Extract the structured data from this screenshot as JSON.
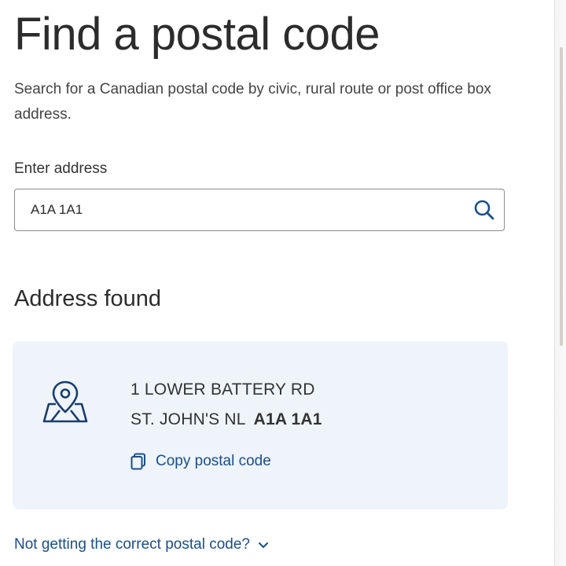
{
  "header": {
    "title": "Find a postal code",
    "intro": "Search for a Canadian postal code by civic, rural route or post office box address."
  },
  "search": {
    "label": "Enter address",
    "value": "A1A 1A1",
    "icon": "search-icon"
  },
  "result": {
    "heading": "Address found",
    "icon": "map-pin-icon",
    "street": "1 LOWER BATTERY RD",
    "city_province": "ST. JOHN'S NL",
    "postal_code": "A1A 1A1",
    "copy_label": "Copy postal code",
    "copy_icon": "copy-icon",
    "card_color": "#eef4fa"
  },
  "footer": {
    "help_link": "Not getting the correct postal code?",
    "help_icon": "chevron-down-icon"
  },
  "colors": {
    "link": "#1a4e8c",
    "text": "#333333"
  }
}
